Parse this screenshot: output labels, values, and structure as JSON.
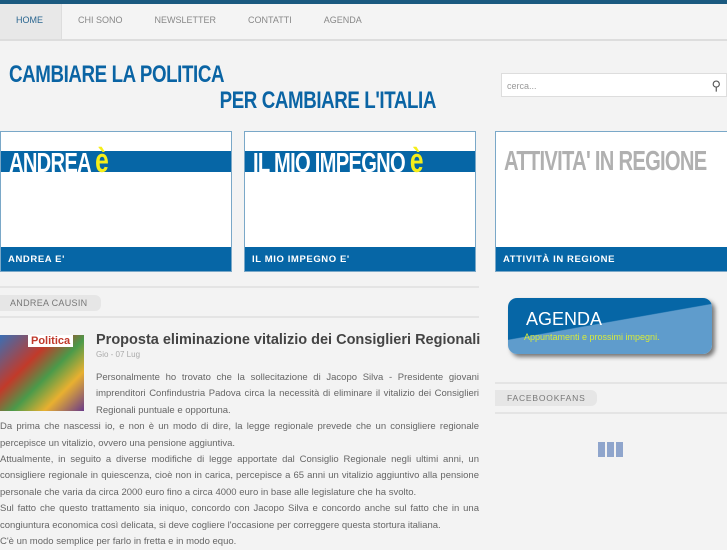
{
  "nav": {
    "items": [
      "HOME",
      "CHI SONO",
      "NEWSLETTER",
      "CONTATTI",
      "AGENDA"
    ]
  },
  "logo": {
    "line1": "CAMBIARE LA POLITICA",
    "line2": "PER CAMBIARE L'ITALIA"
  },
  "search": {
    "placeholder": "cerca..."
  },
  "banners": [
    {
      "big": "ANDREA ",
      "accent": "è",
      "label": "ANDREA E'"
    },
    {
      "big": "IL MIO IMPEGNO ",
      "accent": "è",
      "label": "IL MIO IMPEGNO E'"
    },
    {
      "big": "ATTIVITA' IN REGIONE",
      "accent": "",
      "label": "ATTIVITÀ IN REGIONE"
    }
  ],
  "section": {
    "title": "ANDREA CAUSIN"
  },
  "article": {
    "thumb_text": "Politica",
    "title": "Proposta eliminazione vitalizio dei Consiglieri Regionali",
    "date": "Gio - 07 Lug",
    "paragraphs": [
      "Personalmente  ho trovato che  la sollecitazione di Jacopo Silva - Presidente giovani imprenditori Confindustria Padova circa la necessità di eliminare il vitalizio dei Consiglieri Regionali puntuale e opportuna.",
      "Da prima che nascessi io, e non è un modo di dire, la legge regionale prevede che un consigliere regionale percepisce un vitalizio, ovvero una pensione aggiuntiva.",
      "Attualmente, in seguito a diverse modifiche di legge apportate dal Consiglio Regionale negli ultimi anni, un consigliere regionale in quiescenza, cioè non in carica, percepisce a 65 anni un vitalizio aggiuntivo alla pensione personale che varia da circa 2000 euro fino a circa 4000 euro in base alle legislature che ha svolto.",
      "Sul fatto che questo trattamento sia iniquo, concordo con Jacopo Silva e concordo anche sul fatto che in una congiuntura economica così delicata, si deve cogliere l'occasione per correggere questa stortura italiana.",
      "C'è un modo semplice per farlo in fretta e in modo equo."
    ]
  },
  "agenda": {
    "title": "AGENDA",
    "subtitle": "Appuntamenti e prossimi impegni."
  },
  "facebook": {
    "title": "FACEBOOKFANS"
  }
}
